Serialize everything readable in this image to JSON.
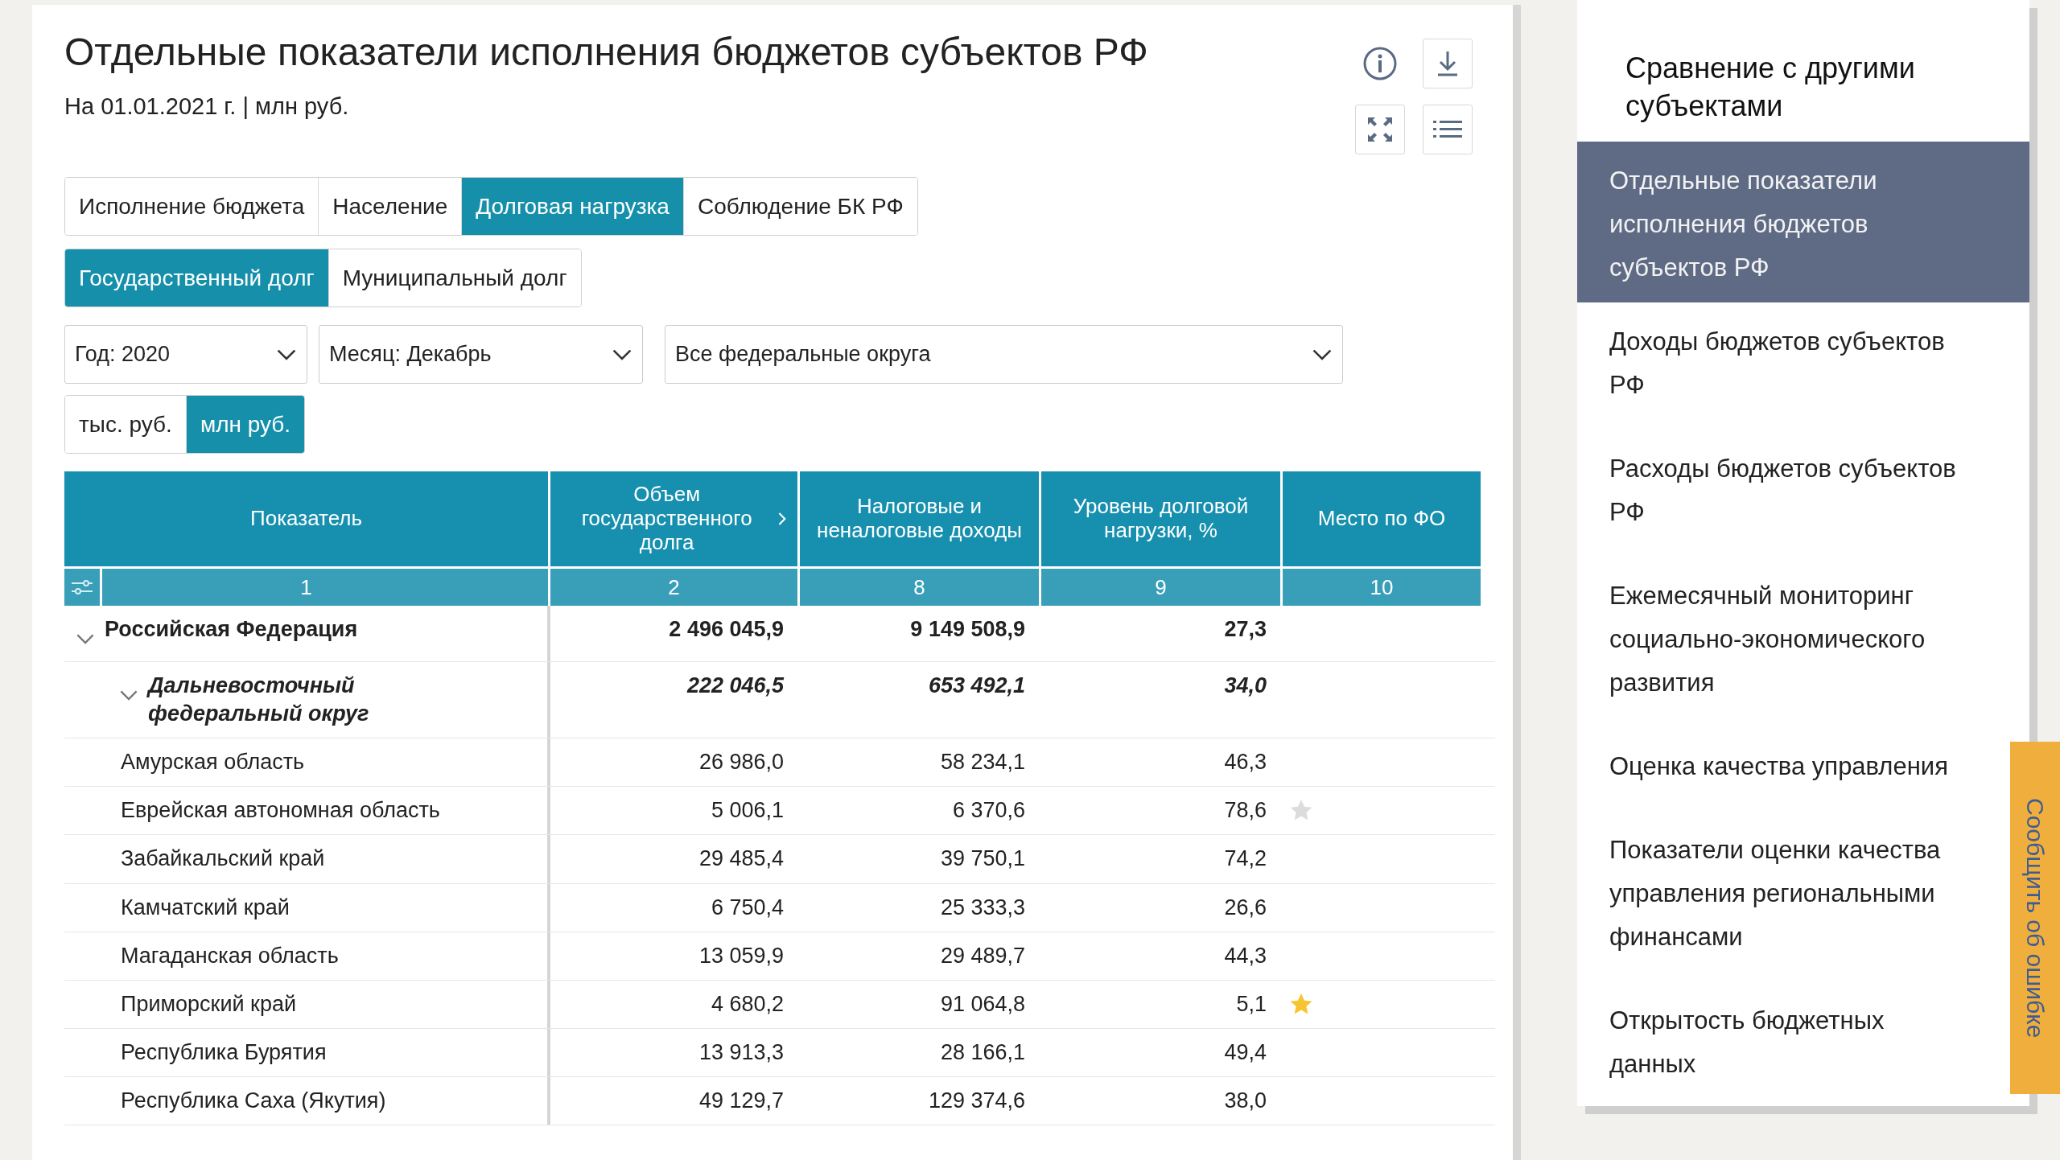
{
  "header": {
    "title": "Отдельные показатели исполнения бюджетов субъектов РФ",
    "subtitle": "На 01.01.2021 г. | млн руб."
  },
  "tabs": [
    {
      "label": "Исполнение бюджета",
      "selected": false
    },
    {
      "label": "Население",
      "selected": false
    },
    {
      "label": "Долговая нагрузка",
      "selected": true
    },
    {
      "label": "Соблюдение БК РФ",
      "selected": false
    }
  ],
  "debt_tabs": [
    {
      "label": "Государственный долг",
      "selected": true
    },
    {
      "label": "Муниципальный долг",
      "selected": false
    }
  ],
  "filters": [
    {
      "value": "Год: 2020"
    },
    {
      "value": "Месяц: Декабрь"
    },
    {
      "value": "Все федеральные округа"
    }
  ],
  "units": [
    {
      "label": "тыс. руб.",
      "selected": false
    },
    {
      "label": "млн руб.",
      "selected": true
    }
  ],
  "table": {
    "columns": [
      {
        "title": "Показатель",
        "number": "1",
        "sortable": false
      },
      {
        "title": "Объем государственного долга",
        "number": "2",
        "sortable": true
      },
      {
        "title": "Налоговые и неналоговые доходы",
        "number": "8",
        "sortable": false
      },
      {
        "title": "Уровень долговой нагрузки, %",
        "number": "9",
        "sortable": false
      },
      {
        "title": "Место по ФО",
        "number": "10",
        "sortable": false
      }
    ],
    "rows": [
      {
        "name": "Российская Федерация",
        "values": [
          "2 496 045,9",
          "9 149 508,9",
          "27,3"
        ],
        "expanded": true,
        "children": [
          {
            "name": "Дальневосточный федеральный округ",
            "values": [
              "222 046,5",
              "653 492,1",
              "34,0"
            ],
            "expanded": true,
            "children": [
              {
                "name": "Амурская область",
                "values": [
                  "26 986,0",
                  "58 234,1",
                  "46,3"
                ]
              },
              {
                "name": "Еврейская автономная область",
                "values": [
                  "5 006,1",
                  "6 370,6",
                  "78,6"
                ],
                "color": "#dcdcdc"
              },
              {
                "name": "Забайкальский край",
                "values": [
                  "29 485,4",
                  "39 750,1",
                  "74,2"
                ]
              },
              {
                "name": "Камчатский край",
                "values": [
                  "6 750,4",
                  "25 333,3",
                  "26,6"
                ]
              },
              {
                "name": "Магаданская область",
                "values": [
                  "13 059,9",
                  "29 489,7",
                  "44,3"
                ]
              },
              {
                "name": "Приморский край",
                "values": [
                  "4 680,2",
                  "91 064,8",
                  "5,1"
                ],
                "color": "#f7c531"
              },
              {
                "name": "Республика Бурятия",
                "values": [
                  "13 913,3",
                  "28 166,1",
                  "49,4"
                ]
              },
              {
                "name": "Республика Саха (Якутия)",
                "values": [
                  "49 129,7",
                  "129 374,6",
                  "38,0"
                ]
              }
            ]
          }
        ]
      }
    ]
  },
  "sidebar": {
    "title": "Сравнение с другими субъектами",
    "items": [
      {
        "label": "Отдельные показатели исполнения бюджетов субъектов РФ",
        "selected": true
      },
      {
        "label": "Доходы бюджетов субъектов РФ",
        "selected": false
      },
      {
        "label": "Расходы бюджетов субъектов РФ",
        "selected": false
      },
      {
        "label": "Ежемесячный мониторинг социально-экономического развития",
        "selected": false
      },
      {
        "label": "Оценка качества управления",
        "selected": false
      },
      {
        "label": "Показатели оценки качества управления региональными финансами",
        "selected": false
      },
      {
        "label": "Открытость бюджетных данных",
        "selected": false
      }
    ]
  },
  "feedback": {
    "label": "Сообщить об ошибке"
  }
}
